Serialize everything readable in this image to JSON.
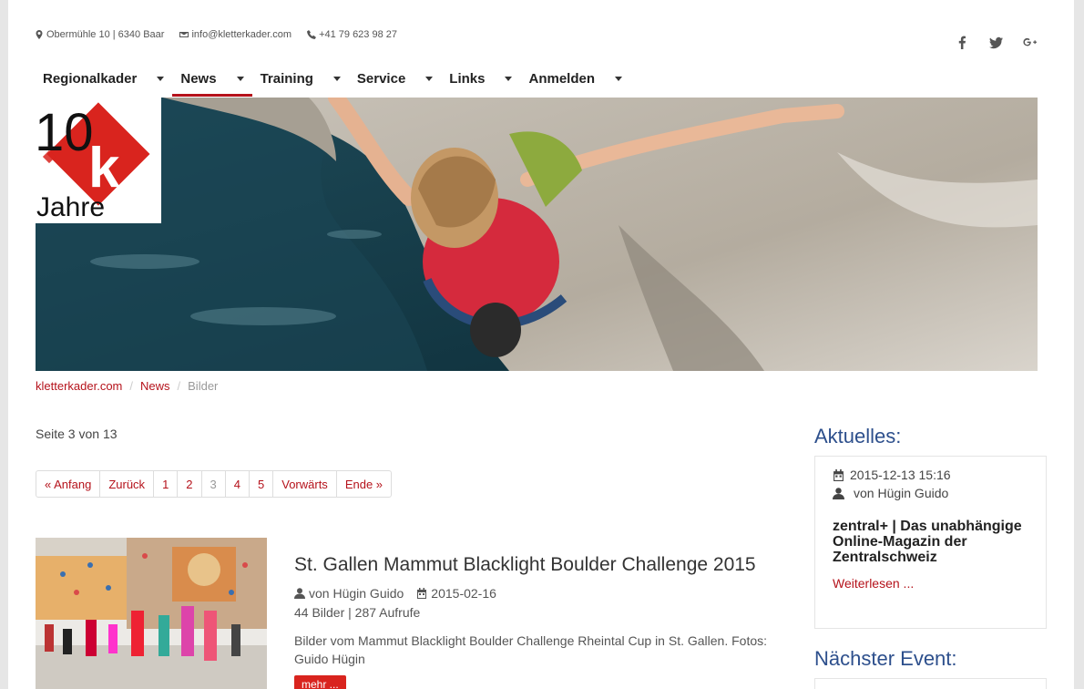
{
  "topbar": {
    "address": "Obermühle 10 | 6340 Baar",
    "email": "info@kletterkader.com",
    "phone": "+41 79 623 98 27"
  },
  "social": [
    "facebook-icon",
    "twitter-icon",
    "google-plus-icon"
  ],
  "nav": {
    "items": [
      {
        "label": "Regionalkader",
        "active": false
      },
      {
        "label": "News",
        "active": true
      },
      {
        "label": "Training",
        "active": false
      },
      {
        "label": "Service",
        "active": false
      },
      {
        "label": "Links",
        "active": false
      },
      {
        "label": "Anmelden",
        "active": false
      }
    ]
  },
  "logo": {
    "number": "10",
    "text": "Jahre",
    "mark": "k"
  },
  "breadcrumb": {
    "items": [
      "kletterkader.com",
      "News",
      "Bilder"
    ]
  },
  "page_count": "Seite 3 von 13",
  "pagination": {
    "items": [
      "« Anfang",
      "Zurück",
      "1",
      "2",
      "3",
      "4",
      "5",
      "Vorwärts",
      "Ende »"
    ],
    "current": "3"
  },
  "article": {
    "title": "St. Gallen Mammut Blacklight Boulder Challenge 2015",
    "author": "von Hügin Guido",
    "date": "2015-02-16",
    "stats": "44 Bilder | 287 Aufrufe",
    "description": "Bilder vom Mammut Blacklight Boulder Challenge Rheintal Cup in St. Gallen. Fotos: Guido Hügin",
    "more": "mehr ..."
  },
  "sidebar": {
    "aktuelles_heading": "Aktuelles:",
    "news": {
      "datetime": "2015-12-13 15:16",
      "author": "von Hügin Guido",
      "title": "zentral+ | Das unabhängige Online-Magazin der Zentralschweiz",
      "link": "Weiterlesen ..."
    },
    "event_heading": "Nächster Event:"
  },
  "colors": {
    "accent": "#b5121b",
    "heading_blue": "#2d4f8c"
  }
}
